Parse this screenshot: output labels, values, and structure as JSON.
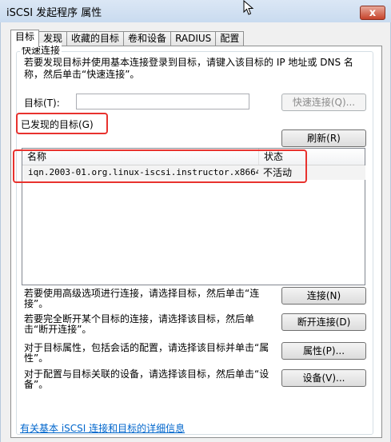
{
  "window": {
    "title": "iSCSI 发起程序 属性",
    "close_label": "x"
  },
  "tabs": [
    {
      "label": "目标"
    },
    {
      "label": "发现"
    },
    {
      "label": "收藏的目标"
    },
    {
      "label": "卷和设备"
    },
    {
      "label": "RADIUS"
    },
    {
      "label": "配置"
    }
  ],
  "quick_connect": {
    "group_label": "快速连接",
    "instruction": "若要发现目标并使用基本连接登录到目标，请键入该目标的 IP 地址或 DNS 名称，然后单击“快速连接”。",
    "target_label": "目标(T):",
    "target_value": "",
    "button": "快速连接(Q)..."
  },
  "discovered": {
    "label": "已发现的目标(G)",
    "refresh_button": "刷新(R)",
    "columns": [
      "名称",
      "状态"
    ],
    "rows": [
      {
        "name": "iqn.2003-01.org.linux-iscsi.instructor.x8664...",
        "status": "不活动"
      }
    ]
  },
  "actions": [
    {
      "desc": "若要使用高级选项进行连接，请选择目标，然后单击“连接”。",
      "button": "连接(N)"
    },
    {
      "desc": "若要完全断开某个目标的连接，请选择该目标，然后单击“断开连接”。",
      "button": "断开连接(D)"
    },
    {
      "desc": "对于目标属性，包括会话的配置，请选择该目标并单击“属性”。",
      "button": "属性(P)..."
    },
    {
      "desc": "对于配置与目标关联的设备，请选择该目标，然后单击“设备”。",
      "button": "设备(V)..."
    }
  ],
  "help_link": "有关基本 iSCSI 连接和目标的详细信息"
}
